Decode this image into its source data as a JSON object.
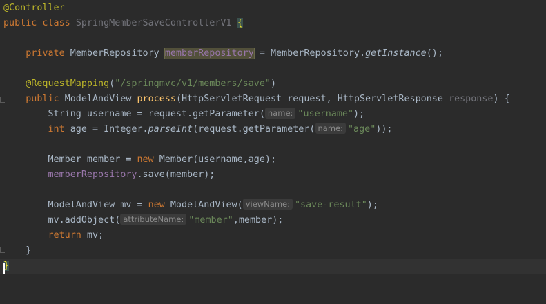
{
  "code": {
    "line_annotation_controller": "@Controller",
    "kw_public_class": "public class",
    "class_name": "SpringMemberSaveControllerV1",
    "open_brace": "{",
    "kw_private": "private",
    "type_member_repository": "MemberRepository",
    "field_member_repository": "memberRepository",
    "assign_get_instance_prefix": " = MemberRepository.",
    "get_instance": "getInstance",
    "get_instance_suffix": "();",
    "request_mapping": "@RequestMapping",
    "request_mapping_open": "(",
    "request_mapping_path": "\"/springmvc/v1/members/save\"",
    "request_mapping_close": ")",
    "kw_public": "public",
    "return_type": "ModelAndView",
    "method_name": "process",
    "params_1": "(HttpServletRequest request, HttpServletResponse ",
    "param_response": "response",
    "params_2": ") {",
    "stmt_username_prefix": "String username = request.getParameter(",
    "hint_name_1": "name:",
    "str_username": "\"username\"",
    "stmt_end_paren_semicolon": ");",
    "kw_int": "int",
    "stmt_age_1": " age = Integer.",
    "parse_int": "parseInt",
    "stmt_age_2": "(request.getParameter(",
    "hint_name_2": "name:",
    "str_age": "\"age\"",
    "stmt_age_end": "));",
    "stmt_member_1": "Member member = ",
    "kw_new": "new",
    "stmt_member_2": " Member(username,age);",
    "field_member_repository_2": "memberRepository",
    "stmt_save": ".save(member);",
    "stmt_mv_1": "ModelAndView mv = ",
    "kw_new_2": "new",
    "stmt_mv_2": " ModelAndView(",
    "hint_view_name": "viewName:",
    "str_save_result": "\"save-result\"",
    "stmt_mv_end": ");",
    "stmt_add_object_1": "mv.addObject(",
    "hint_attribute_name": "attributeName:",
    "str_member": "\"member\"",
    "stmt_add_object_2": ",member);",
    "kw_return": "return",
    "stmt_return": " mv;",
    "close_method_brace": "}",
    "close_class_brace": "}"
  },
  "colors": {
    "background": "#2b2b2b",
    "keyword": "#cc7832",
    "annotation": "#bbb529",
    "string": "#6a8759",
    "field": "#9876aa",
    "method_declaration": "#ffc66d",
    "default_text": "#a9b7c6"
  }
}
